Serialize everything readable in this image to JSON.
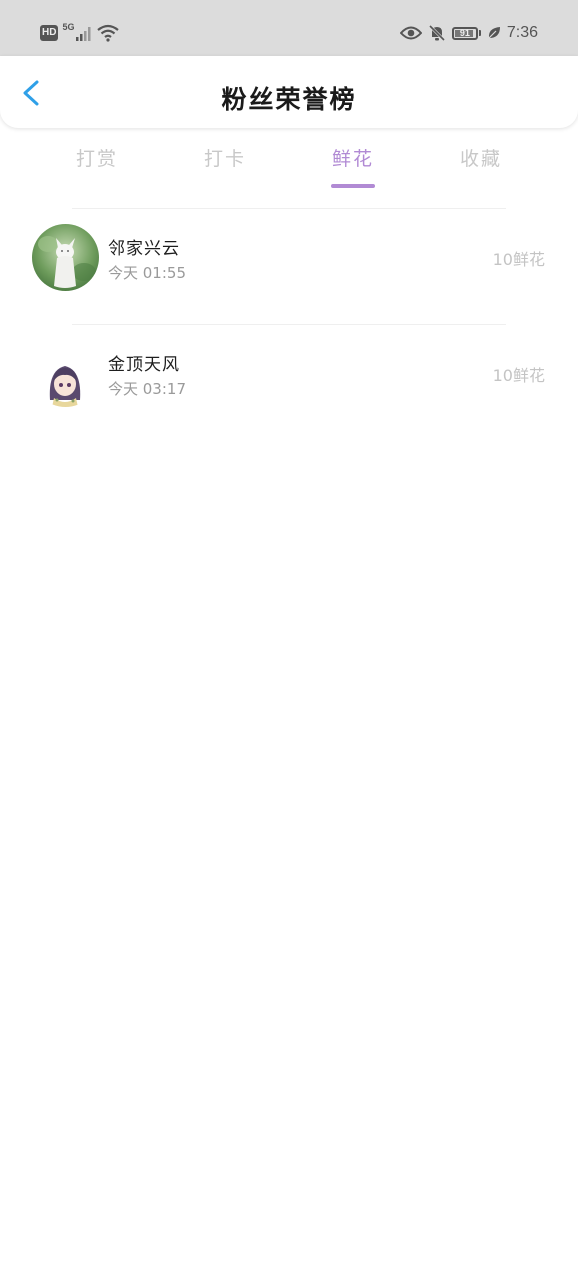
{
  "status_bar": {
    "hd": "HD",
    "network": "5G",
    "battery": "91",
    "battery_level": 0.91,
    "time": "7:36",
    "icons": [
      "signal-icon",
      "wifi-icon",
      "eye-icon",
      "mute-bell-icon",
      "battery-icon",
      "leaf-icon"
    ]
  },
  "header": {
    "title": "粉丝荣誉榜",
    "back_icon": "chevron-left-icon",
    "accent_color": "#2fa0e8"
  },
  "tabs": [
    {
      "label": "打赏",
      "active": false
    },
    {
      "label": "打卡",
      "active": false
    },
    {
      "label": "鲜花",
      "active": true
    },
    {
      "label": "收藏",
      "active": false
    }
  ],
  "active_tab_color": "#b18ad4",
  "list": [
    {
      "name": "邻家兴云",
      "time": "今天 01:55",
      "amount": "10鲜花",
      "avatar": "white-cat-avatar"
    },
    {
      "name": "金顶天风",
      "time": "今天 03:17",
      "amount": "10鲜花",
      "avatar": "anime-girl-avatar"
    }
  ]
}
